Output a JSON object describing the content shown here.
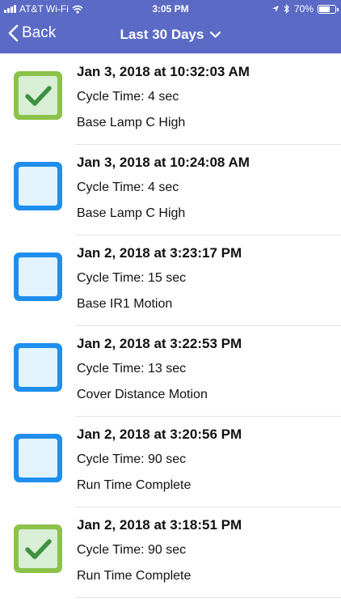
{
  "status_bar": {
    "carrier": "AT&T Wi-Fi",
    "time": "3:05 PM",
    "battery": "70%",
    "battery_level": 0.7
  },
  "nav": {
    "back_label": "Back",
    "title": "Last 30 Days"
  },
  "colors": {
    "header": "#5b6ac4",
    "checked": "#8cc24a",
    "unchecked": "#1e8fee"
  },
  "events": [
    {
      "timestamp": "Jan 3, 2018 at 10:32:03 AM",
      "cycle_time": "Cycle Time: 4 sec",
      "source": "Base Lamp C High",
      "checked": true
    },
    {
      "timestamp": "Jan 3, 2018 at 10:24:08 AM",
      "cycle_time": "Cycle Time: 4 sec",
      "source": "Base Lamp C High",
      "checked": false
    },
    {
      "timestamp": "Jan 2, 2018 at 3:23:17 PM",
      "cycle_time": "Cycle Time: 15 sec",
      "source": "Base IR1 Motion",
      "checked": false
    },
    {
      "timestamp": "Jan 2, 2018 at 3:22:53 PM",
      "cycle_time": "Cycle Time: 13 sec",
      "source": "Cover Distance Motion",
      "checked": false
    },
    {
      "timestamp": "Jan 2, 2018 at 3:20:56 PM",
      "cycle_time": "Cycle Time: 90 sec",
      "source": "Run Time Complete",
      "checked": false
    },
    {
      "timestamp": "Jan 2, 2018 at 3:18:51 PM",
      "cycle_time": "Cycle Time: 90 sec",
      "source": "Run Time Complete",
      "checked": true
    }
  ]
}
